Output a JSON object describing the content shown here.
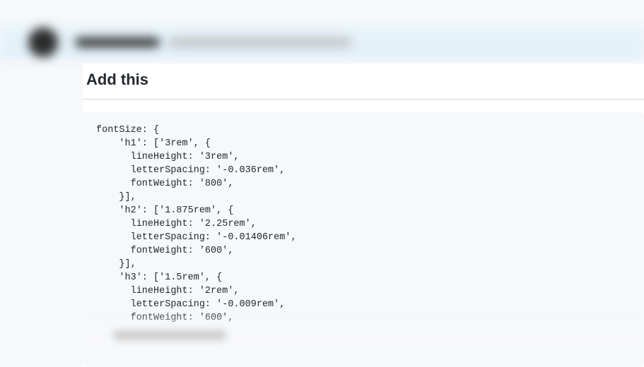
{
  "header": {
    "username_placeholder": "",
    "meta_placeholder": ""
  },
  "section": {
    "title": "Add this"
  },
  "code": {
    "content": "fontSize: {\n    'h1': ['3rem', {\n      lineHeight: '3rem',\n      letterSpacing: '-0.036rem',\n      fontWeight: '800',\n    }],\n    'h2': ['1.875rem', {\n      lineHeight: '2.25rem',\n      letterSpacing: '-0.01406rem',\n      fontWeight: '600',\n    }],\n    'h3': ['1.5rem', {\n      lineHeight: '2rem',\n      letterSpacing: '-0.009rem',\n      fontWeight: '600',"
  }
}
